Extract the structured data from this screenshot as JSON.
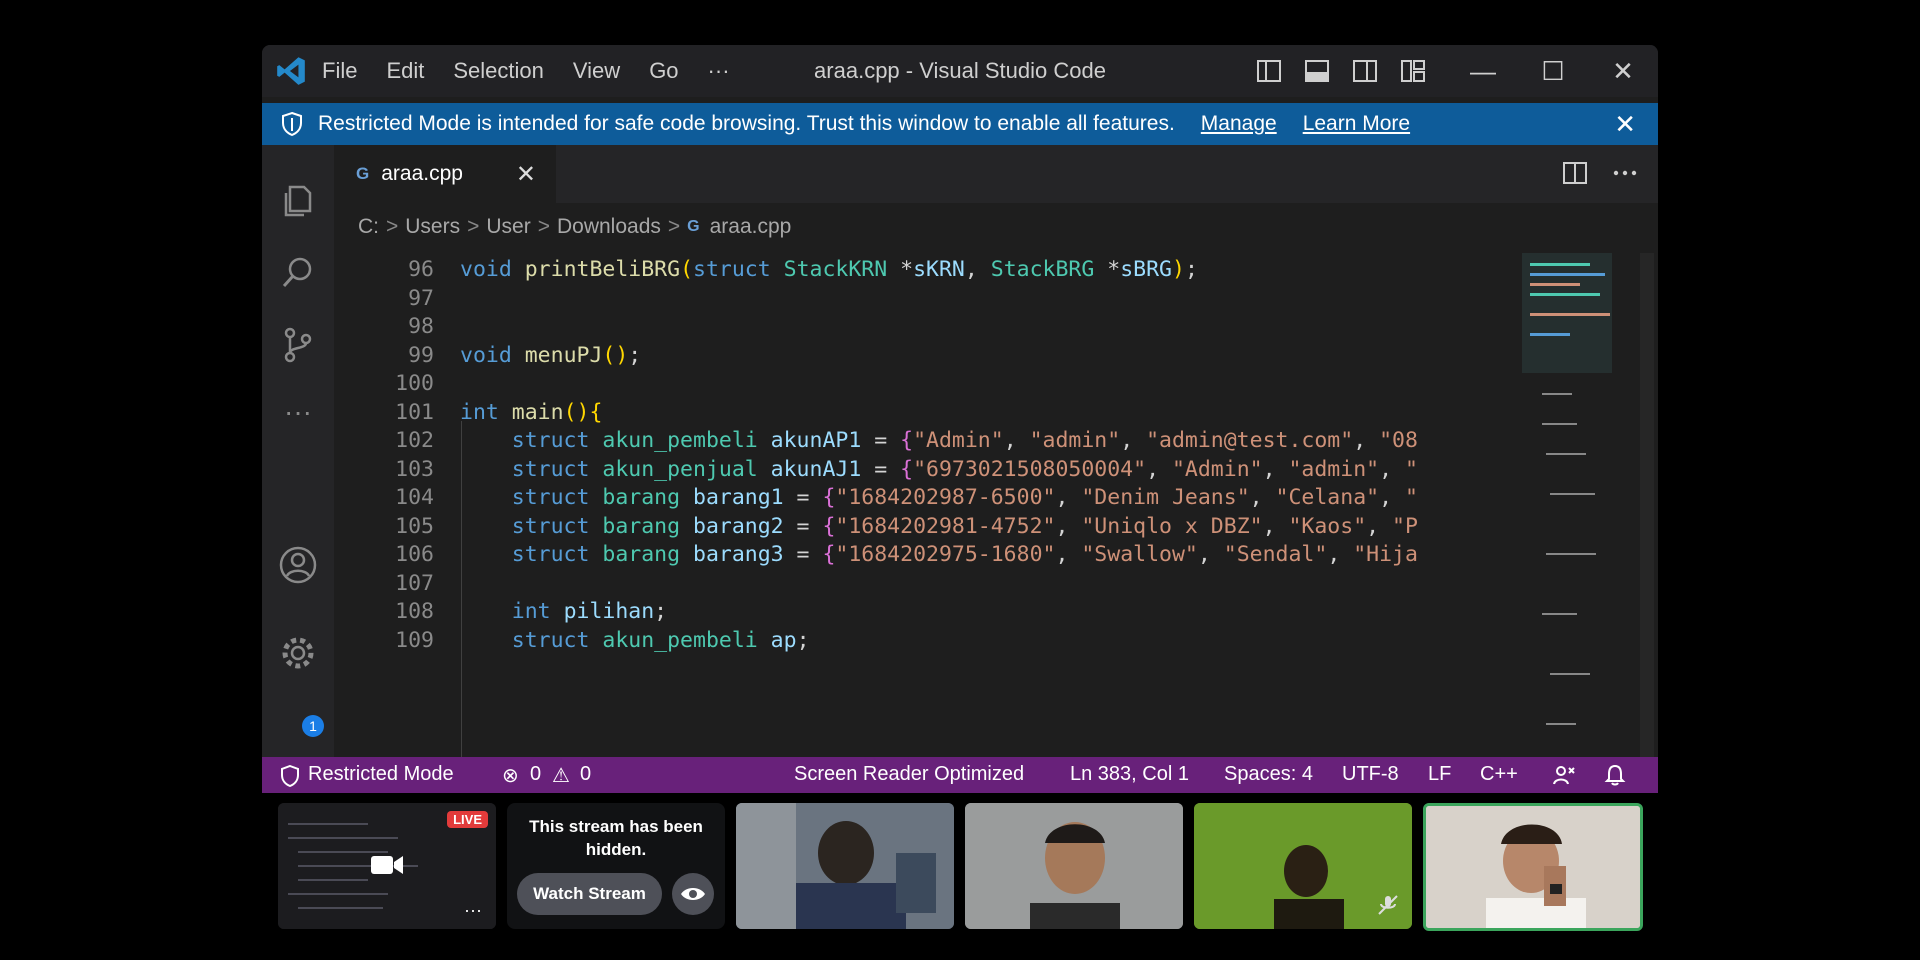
{
  "titlebar": {
    "menu": [
      "File",
      "Edit",
      "Selection",
      "View",
      "Go",
      "···"
    ],
    "title": "araa.cpp - Visual Studio Code",
    "controls": {
      "minimize": "—",
      "maximize": "☐",
      "close": "✕"
    }
  },
  "banner": {
    "message": "Restricted Mode is intended for safe code browsing. Trust this window to enable all features.",
    "manage": "Manage",
    "learn_more": "Learn More",
    "close": "✕"
  },
  "activity": {
    "more": "···",
    "settings_badge": "1"
  },
  "tab": {
    "icon_text": "G",
    "name": "araa.cpp",
    "close": "✕"
  },
  "breadcrumb": {
    "parts": [
      "C:",
      "Users",
      "User",
      "Downloads"
    ],
    "sep": ">",
    "file_icon": "G",
    "file": "araa.cpp"
  },
  "code_lines": [
    {
      "n": "96",
      "segs": [
        [
          "kw",
          "void "
        ],
        [
          "fn",
          "printBeliBRG"
        ],
        [
          "p1",
          "("
        ],
        [
          "kw",
          "struct "
        ],
        [
          "ty",
          "StackKRN "
        ],
        [
          "op",
          "*"
        ],
        [
          "var",
          "sKRN"
        ],
        [
          "op",
          ", "
        ],
        [
          "ty",
          "StackBRG "
        ],
        [
          "op",
          "*"
        ],
        [
          "var",
          "sBRG"
        ],
        [
          "p1",
          ")"
        ],
        [
          "op",
          ";"
        ]
      ]
    },
    {
      "n": "97",
      "segs": []
    },
    {
      "n": "98",
      "segs": []
    },
    {
      "n": "99",
      "segs": [
        [
          "kw",
          "void "
        ],
        [
          "fn",
          "menuPJ"
        ],
        [
          "p1",
          "()"
        ],
        [
          "op",
          ";"
        ]
      ]
    },
    {
      "n": "100",
      "segs": []
    },
    {
      "n": "101",
      "segs": [
        [
          "kw",
          "int "
        ],
        [
          "fn",
          "main"
        ],
        [
          "p1",
          "()"
        ],
        [
          "p1",
          "{"
        ]
      ]
    },
    {
      "n": "102",
      "segs": [
        [
          "op",
          "    "
        ],
        [
          "kw",
          "struct "
        ],
        [
          "ty",
          "akun_pembeli "
        ],
        [
          "var",
          "akunAP1"
        ],
        [
          "op",
          " = "
        ],
        [
          "p2",
          "{"
        ],
        [
          "str",
          "\"Admin\""
        ],
        [
          "op",
          ", "
        ],
        [
          "str",
          "\"admin\""
        ],
        [
          "op",
          ", "
        ],
        [
          "str",
          "\"admin@test.com\""
        ],
        [
          "op",
          ", "
        ],
        [
          "str",
          "\"08"
        ]
      ]
    },
    {
      "n": "103",
      "segs": [
        [
          "op",
          "    "
        ],
        [
          "kw",
          "struct "
        ],
        [
          "ty",
          "akun_penjual "
        ],
        [
          "var",
          "akunAJ1"
        ],
        [
          "op",
          " = "
        ],
        [
          "p2",
          "{"
        ],
        [
          "str",
          "\"6973021508050004\""
        ],
        [
          "op",
          ", "
        ],
        [
          "str",
          "\"Admin\""
        ],
        [
          "op",
          ", "
        ],
        [
          "str",
          "\"admin\""
        ],
        [
          "op",
          ", "
        ],
        [
          "str",
          "\""
        ]
      ]
    },
    {
      "n": "104",
      "segs": [
        [
          "op",
          "    "
        ],
        [
          "kw",
          "struct "
        ],
        [
          "ty",
          "barang "
        ],
        [
          "var",
          "barang1"
        ],
        [
          "op",
          " = "
        ],
        [
          "p2",
          "{"
        ],
        [
          "str",
          "\"1684202987-6500\""
        ],
        [
          "op",
          ", "
        ],
        [
          "str",
          "\"Denim Jeans\""
        ],
        [
          "op",
          ", "
        ],
        [
          "str",
          "\"Celana\""
        ],
        [
          "op",
          ", "
        ],
        [
          "str",
          "\""
        ]
      ]
    },
    {
      "n": "105",
      "segs": [
        [
          "op",
          "    "
        ],
        [
          "kw",
          "struct "
        ],
        [
          "ty",
          "barang "
        ],
        [
          "var",
          "barang2"
        ],
        [
          "op",
          " = "
        ],
        [
          "p2",
          "{"
        ],
        [
          "str",
          "\"1684202981-4752\""
        ],
        [
          "op",
          ", "
        ],
        [
          "str",
          "\"Uniqlo x DBZ\""
        ],
        [
          "op",
          ", "
        ],
        [
          "str",
          "\"Kaos\""
        ],
        [
          "op",
          ", "
        ],
        [
          "str",
          "\"P"
        ]
      ]
    },
    {
      "n": "106",
      "segs": [
        [
          "op",
          "    "
        ],
        [
          "kw",
          "struct "
        ],
        [
          "ty",
          "barang "
        ],
        [
          "var",
          "barang3"
        ],
        [
          "op",
          " = "
        ],
        [
          "p2",
          "{"
        ],
        [
          "str",
          "\"1684202975-1680\""
        ],
        [
          "op",
          ", "
        ],
        [
          "str",
          "\"Swallow\""
        ],
        [
          "op",
          ", "
        ],
        [
          "str",
          "\"Sendal\""
        ],
        [
          "op",
          ", "
        ],
        [
          "str",
          "\"Hija"
        ]
      ]
    },
    {
      "n": "107",
      "segs": []
    },
    {
      "n": "108",
      "segs": [
        [
          "op",
          "    "
        ],
        [
          "kw",
          "int "
        ],
        [
          "var",
          "pilihan"
        ],
        [
          "op",
          ";"
        ]
      ]
    },
    {
      "n": "109",
      "segs": [
        [
          "op",
          "    "
        ],
        [
          "kw",
          "struct "
        ],
        [
          "ty",
          "akun_pembeli "
        ],
        [
          "var",
          "ap"
        ],
        [
          "op",
          ";"
        ]
      ]
    }
  ],
  "statusbar": {
    "restricted": "Restricted Mode",
    "errors": "0",
    "warnings": "0",
    "screen_reader": "Screen Reader Optimized",
    "position": "Ln 383, Col 1",
    "spaces": "Spaces: 4",
    "encoding": "UTF-8",
    "eol": "LF",
    "language": "C++"
  },
  "call": {
    "live_badge": "LIVE",
    "hidden_message": "This stream has been hidden.",
    "watch_stream": "Watch Stream",
    "more": "···"
  },
  "colors": {
    "banner": "#0e5c9a",
    "statusbar": "#68217a",
    "live": "#e23b3b"
  }
}
